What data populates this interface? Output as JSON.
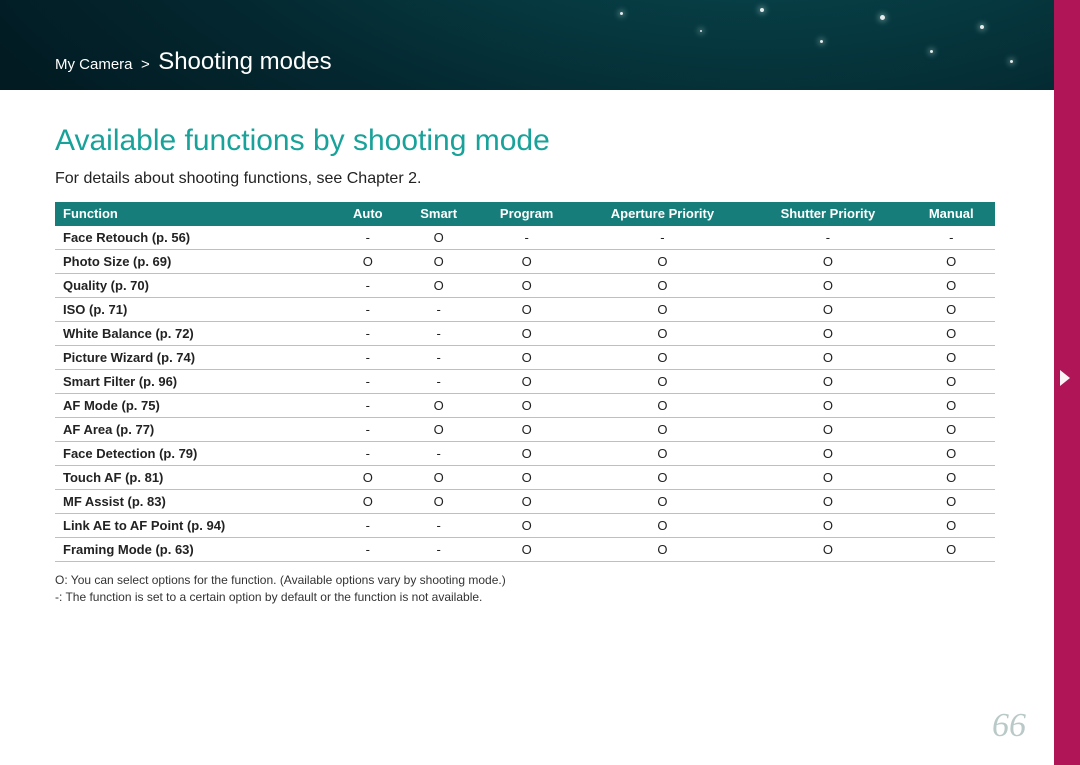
{
  "breadcrumb": {
    "parent": "My Camera",
    "sep": ">",
    "current": "Shooting modes"
  },
  "title": "Available functions by shooting mode",
  "intro": "For details about shooting functions, see Chapter 2.",
  "columns": [
    "Function",
    "Auto",
    "Smart",
    "Program",
    "Aperture Priority",
    "Shutter Priority",
    "Manual"
  ],
  "rows": [
    {
      "fn": "Face Retouch (p. 56)",
      "vals": [
        "-",
        "O",
        "-",
        "-",
        "-",
        "-"
      ]
    },
    {
      "fn": "Photo Size (p. 69)",
      "vals": [
        "O",
        "O",
        "O",
        "O",
        "O",
        "O"
      ]
    },
    {
      "fn": "Quality (p. 70)",
      "vals": [
        "-",
        "O",
        "O",
        "O",
        "O",
        "O"
      ]
    },
    {
      "fn": "ISO (p. 71)",
      "vals": [
        "-",
        "-",
        "O",
        "O",
        "O",
        "O"
      ]
    },
    {
      "fn": "White Balance (p. 72)",
      "vals": [
        "-",
        "-",
        "O",
        "O",
        "O",
        "O"
      ]
    },
    {
      "fn": "Picture Wizard (p. 74)",
      "vals": [
        "-",
        "-",
        "O",
        "O",
        "O",
        "O"
      ]
    },
    {
      "fn": "Smart Filter (p. 96)",
      "vals": [
        "-",
        "-",
        "O",
        "O",
        "O",
        "O"
      ]
    },
    {
      "fn": "AF Mode (p. 75)",
      "vals": [
        "-",
        "O",
        "O",
        "O",
        "O",
        "O"
      ]
    },
    {
      "fn": "AF Area (p. 77)",
      "vals": [
        "-",
        "O",
        "O",
        "O",
        "O",
        "O"
      ]
    },
    {
      "fn": "Face Detection (p. 79)",
      "vals": [
        "-",
        "-",
        "O",
        "O",
        "O",
        "O"
      ]
    },
    {
      "fn": "Touch AF (p. 81)",
      "vals": [
        "O",
        "O",
        "O",
        "O",
        "O",
        "O"
      ]
    },
    {
      "fn": "MF Assist (p. 83)",
      "vals": [
        "O",
        "O",
        "O",
        "O",
        "O",
        "O"
      ]
    },
    {
      "fn": "Link AE to AF Point (p. 94)",
      "vals": [
        "-",
        "-",
        "O",
        "O",
        "O",
        "O"
      ]
    },
    {
      "fn": "Framing Mode (p. 63)",
      "vals": [
        "-",
        "-",
        "O",
        "O",
        "O",
        "O"
      ]
    }
  ],
  "notes": [
    "O: You can select options for the function. (Available options vary by shooting mode.)",
    "-: The function is set to a certain option by default or the function is not available."
  ],
  "chart_data": {
    "type": "table",
    "columns": [
      "Function",
      "Auto",
      "Smart",
      "Program",
      "Aperture Priority",
      "Shutter Priority",
      "Manual"
    ],
    "rows": [
      [
        "Face Retouch (p. 56)",
        "-",
        "O",
        "-",
        "-",
        "-",
        "-"
      ],
      [
        "Photo Size (p. 69)",
        "O",
        "O",
        "O",
        "O",
        "O",
        "O"
      ],
      [
        "Quality (p. 70)",
        "-",
        "O",
        "O",
        "O",
        "O",
        "O"
      ],
      [
        "ISO (p. 71)",
        "-",
        "-",
        "O",
        "O",
        "O",
        "O"
      ],
      [
        "White Balance (p. 72)",
        "-",
        "-",
        "O",
        "O",
        "O",
        "O"
      ],
      [
        "Picture Wizard (p. 74)",
        "-",
        "-",
        "O",
        "O",
        "O",
        "O"
      ],
      [
        "Smart Filter (p. 96)",
        "-",
        "-",
        "O",
        "O",
        "O",
        "O"
      ],
      [
        "AF Mode (p. 75)",
        "-",
        "O",
        "O",
        "O",
        "O",
        "O"
      ],
      [
        "AF Area (p. 77)",
        "-",
        "O",
        "O",
        "O",
        "O",
        "O"
      ],
      [
        "Face Detection (p. 79)",
        "-",
        "-",
        "O",
        "O",
        "O",
        "O"
      ],
      [
        "Touch AF (p. 81)",
        "O",
        "O",
        "O",
        "O",
        "O",
        "O"
      ],
      [
        "MF Assist (p. 83)",
        "O",
        "O",
        "O",
        "O",
        "O",
        "O"
      ],
      [
        "Link AE to AF Point (p. 94)",
        "-",
        "-",
        "O",
        "O",
        "O",
        "O"
      ],
      [
        "Framing Mode (p. 63)",
        "-",
        "-",
        "O",
        "O",
        "O",
        "O"
      ]
    ],
    "legend": {
      "O": "selectable",
      "-": "default/unavailable"
    }
  },
  "page_number": "66"
}
